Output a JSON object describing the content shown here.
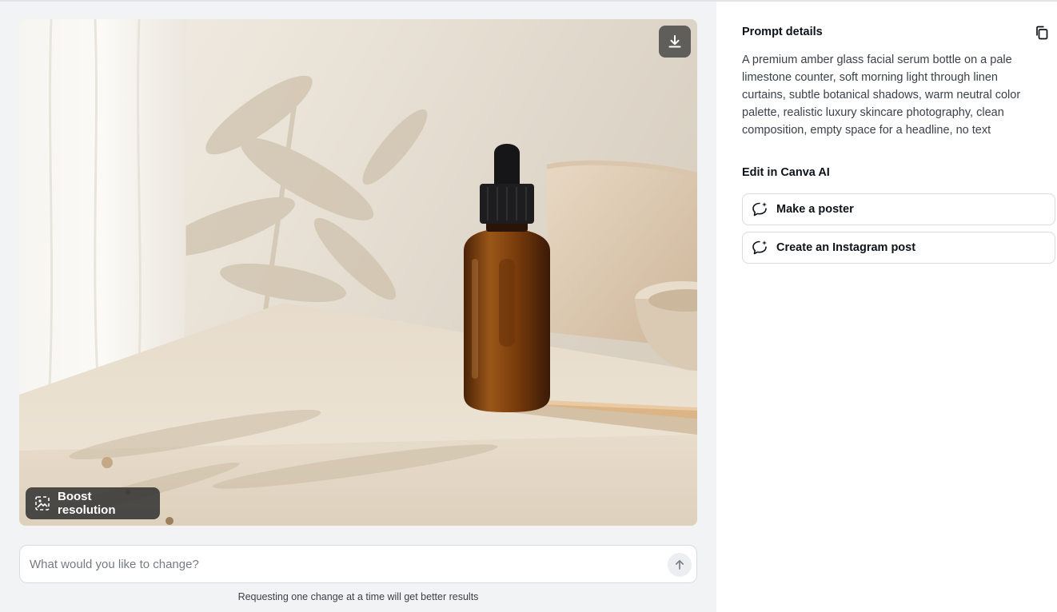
{
  "image": {
    "download_icon": "download-icon",
    "boost_label": "Boost resolution",
    "boost_icon": "boost-resolution-icon"
  },
  "change_box": {
    "placeholder": "What would you like to change?",
    "send_icon": "arrow-up-icon",
    "hint": "Requesting one change at a time will get better results"
  },
  "details": {
    "prompt_title": "Prompt details",
    "copy_icon": "copy-icon",
    "prompt_text": "A premium amber glass facial serum bottle on a pale limestone counter, soft morning light through linen curtains, subtle botanical shadows, warm neutral color palette, realistic luxury skincare photography, clean composition, empty space for a headline, no text",
    "edit_title": "Edit in Canva AI",
    "actions": [
      {
        "label": "Make a poster",
        "icon": "chat-sparkle-icon"
      },
      {
        "label": "Create an Instagram post",
        "icon": "chat-sparkle-icon"
      }
    ]
  },
  "colors": {
    "left_background": "#f2f3f5",
    "right_background": "#ffffff",
    "amber_bottle": "#8a4a12",
    "border": "#d8dbe0"
  }
}
